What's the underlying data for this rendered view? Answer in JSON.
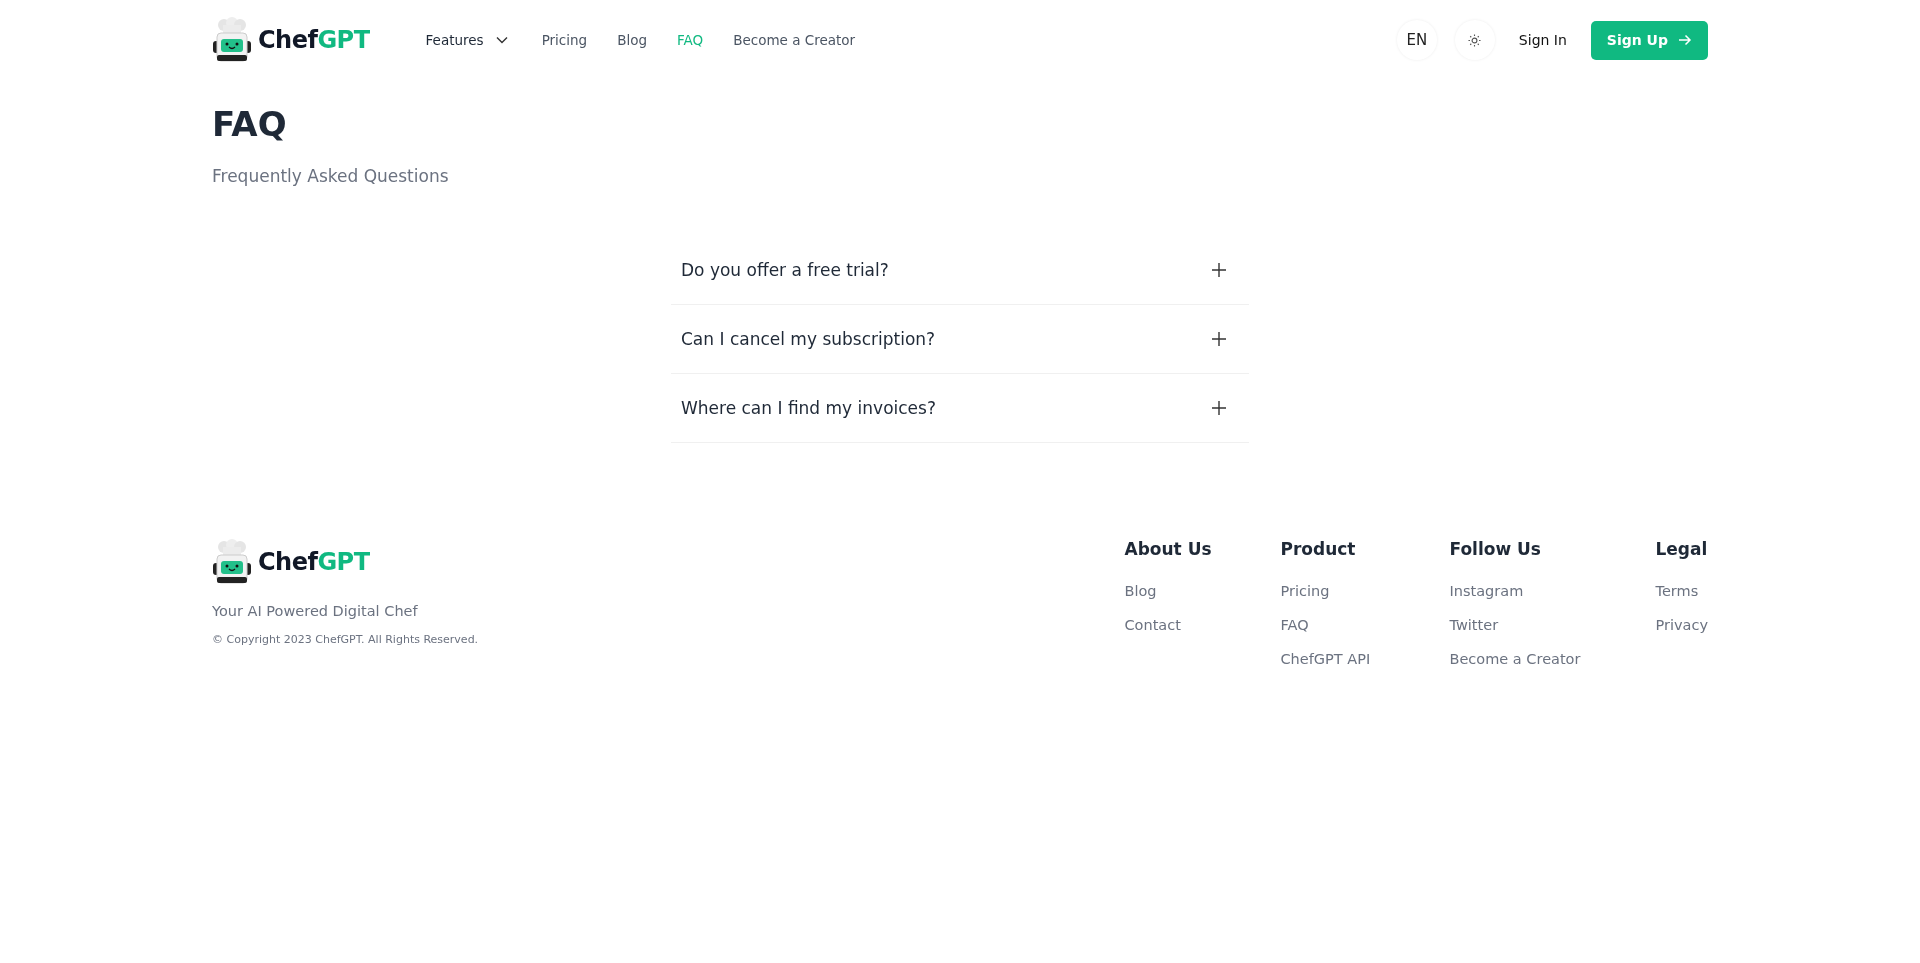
{
  "header": {
    "brand": {
      "part_1": "Chef",
      "part_2": "GPT"
    },
    "nav": [
      {
        "label": "Features",
        "kind": "dropdown",
        "selected": false
      },
      {
        "label": "Pricing",
        "kind": "link",
        "selected": false
      },
      {
        "label": "Blog",
        "kind": "link",
        "selected": false
      },
      {
        "label": "FAQ",
        "kind": "link",
        "selected": true
      },
      {
        "label": "Become a Creator",
        "kind": "link",
        "selected": false
      }
    ],
    "language": "EN",
    "sign_in": "Sign In",
    "sign_up": "Sign Up"
  },
  "page": {
    "title": "FAQ",
    "subtitle": "Frequently Asked Questions"
  },
  "faq": [
    {
      "question": "Do you offer a free trial?",
      "expanded": false
    },
    {
      "question": "Can I cancel my subscription?",
      "expanded": false
    },
    {
      "question": "Where can I find my invoices?",
      "expanded": false
    }
  ],
  "footer": {
    "brand": {
      "part_1": "Chef",
      "part_2": "GPT"
    },
    "tagline": "Your AI Powered Digital Chef",
    "copyright": "© Copyright 2023 ChefGPT. All Rights Reserved.",
    "columns": [
      {
        "heading": "About Us",
        "links": [
          "Blog",
          "Contact"
        ]
      },
      {
        "heading": "Product",
        "links": [
          "Pricing",
          "FAQ",
          "ChefGPT API"
        ]
      },
      {
        "heading": "Follow Us",
        "links": [
          "Instagram",
          "Twitter",
          "Become a Creator"
        ]
      },
      {
        "heading": "Legal",
        "links": [
          "Terms",
          "Privacy"
        ]
      }
    ]
  }
}
